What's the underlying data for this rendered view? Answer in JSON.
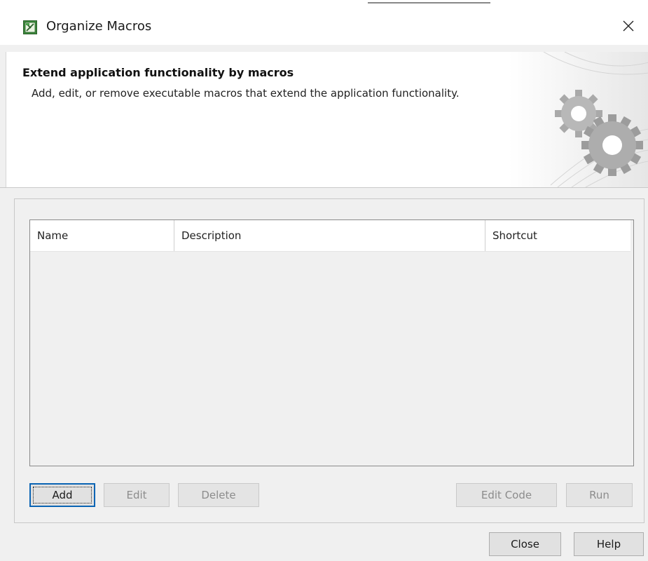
{
  "window": {
    "title": "Organize Macros",
    "app_icon": "macro-app-icon",
    "close_icon": "close-icon"
  },
  "banner": {
    "heading": "Extend application functionality by macros",
    "description": "Add, edit, or remove executable macros that extend the application functionality.",
    "art_icon": "gears-icon"
  },
  "macros_table": {
    "columns": [
      "Name",
      "Description",
      "Shortcut"
    ],
    "rows": []
  },
  "table_buttons": {
    "add": "Add",
    "edit": "Edit",
    "delete": "Delete",
    "edit_code": "Edit Code",
    "run": "Run"
  },
  "dialog_buttons": {
    "close": "Close",
    "help": "Help"
  },
  "colors": {
    "dialog_background": "#f0f0f0",
    "focus_border": "#0a64b4",
    "disabled_text": "#8c8c8c"
  }
}
